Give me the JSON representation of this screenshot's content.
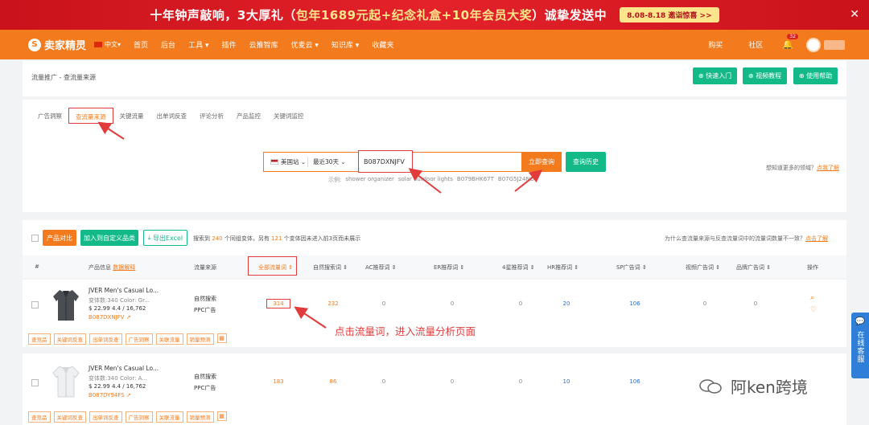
{
  "banner": {
    "text_a": "十年钟声敲响，3大厚礼（",
    "text_hl": "包年1689元起+纪念礼盒+10年会员大奖",
    "text_b": "）诚挚发送中",
    "cta": "8.08-8.18  邀诣惊喜 >>",
    "close": "✕"
  },
  "nav": {
    "logo": "卖家精灵",
    "lang": "中文",
    "items": [
      "首页",
      "后台",
      "工具",
      "插件",
      "云推智库",
      "优麦云",
      "知识库",
      "收藏夹"
    ],
    "right": {
      "buy": "购买",
      "community": "社区",
      "bell_count": "32"
    }
  },
  "page": {
    "breadcrumb": "流量推广 - 查流量来源",
    "top_buttons": [
      "快速入门",
      "视频教程",
      "使用帮助"
    ],
    "tabs": [
      "广告洞察",
      "查流量来源",
      "关键流量",
      "出单词反查",
      "评论分析",
      "产品监控",
      "关键词监控"
    ]
  },
  "search": {
    "market": "美国站",
    "range": "最近30天",
    "value": "B087DXNJFV",
    "submit": "立即查询",
    "history": "查询历史",
    "examples_label": "示例:",
    "examples": [
      "shower organizer",
      "solar outdoor lights",
      "B079BHK67T",
      "B07G5J24ND"
    ],
    "help_text": "想知道更多的领域？",
    "help_link": "点我了解"
  },
  "toolbar": {
    "compare": "产品对比",
    "add_cat": "加入到自定义品类",
    "export": "导出Excel",
    "summary_a": "搜索到 ",
    "summary_n1": "240",
    "summary_b": " 个同组变体，另有 ",
    "summary_n2": "121",
    "summary_c": " 个变体因未进入前3页而未展示",
    "faq_text": "为什么查流量来源与反查流量词中的流量词数量不一致？",
    "faq_link": "点击了解"
  },
  "table": {
    "headers": [
      "#",
      "产品信息",
      "数据解释",
      "流量来源",
      "全部流量词",
      "自然搜索词",
      "AC推荐词",
      "ER推荐词",
      "4星推荐词",
      "HR推荐词",
      "SP广告词",
      "视频广告词",
      "品牌广告词",
      "操作"
    ],
    "rows": [
      {
        "name": "JVER Men's Casual Lo...",
        "meta": "变体数:340    Color: Gr...",
        "price": "$ 22.99   4.4 / 16,762",
        "asin": "B087DXNJFV",
        "sources": [
          "自然搜索",
          "PPC广告"
        ],
        "values": [
          "314",
          "232",
          "0",
          "0",
          "0",
          "20",
          "106",
          "0",
          "0"
        ]
      },
      {
        "name": "JVER Men's Casual Lo...",
        "meta": "变体数:340    Color: A...",
        "price": "$ 22.99   4.4 / 16,762",
        "asin": "B087DY94FS",
        "sources": [
          "自然搜索",
          "PPC广告"
        ],
        "values": [
          "183",
          "86",
          "0",
          "0",
          "0",
          "10",
          "106",
          "0",
          "0"
        ]
      }
    ],
    "chips": [
      "查竞品",
      "关键词反查",
      "出单词反查",
      "广告洞察",
      "关联流量",
      "销量预测"
    ]
  },
  "annotation": "点击流量词，进入流量分析页面",
  "side": {
    "label": "在线客服"
  },
  "watermark": "阿ken跨境",
  "colors": {
    "brand": "#f47b1d",
    "teal": "#14b98a",
    "banner_red": "#e4222a",
    "annotation_red": "#e23b3b"
  }
}
